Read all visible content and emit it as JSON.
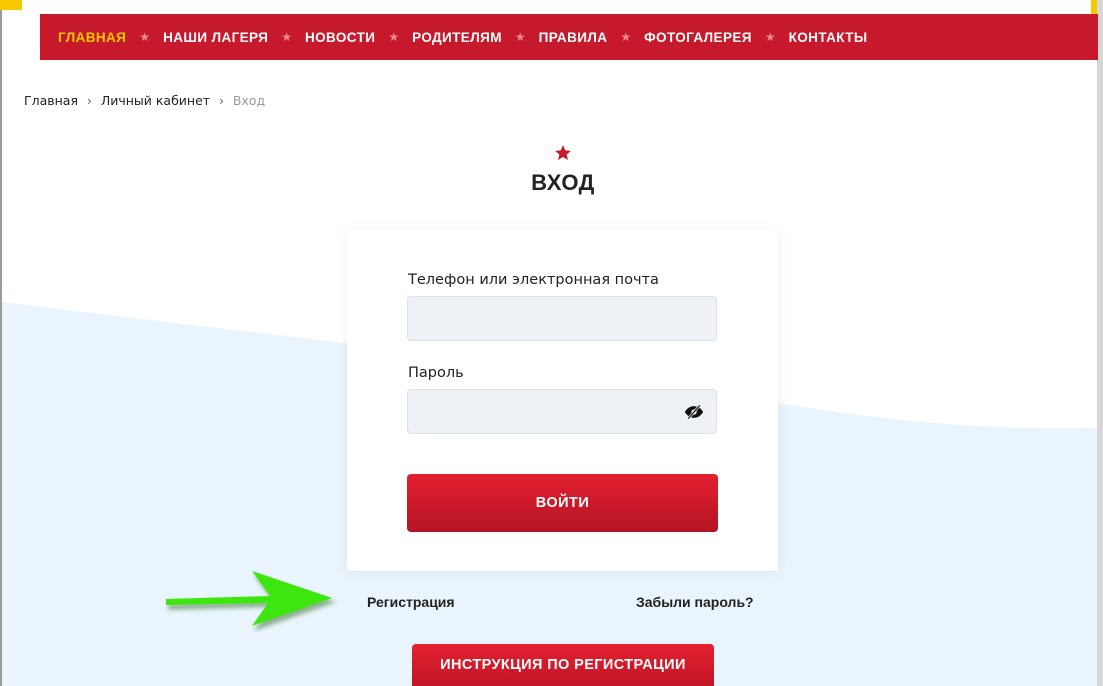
{
  "nav": {
    "items": [
      {
        "label": "ГЛАВНАЯ",
        "active": true
      },
      {
        "label": "НАШИ ЛАГЕРЯ",
        "active": false
      },
      {
        "label": "НОВОСТИ",
        "active": false
      },
      {
        "label": "РОДИТЕЛЯМ",
        "active": false
      },
      {
        "label": "ПРАВИЛА",
        "active": false
      },
      {
        "label": "ФОТОГАЛЕРЕЯ",
        "active": false
      },
      {
        "label": "КОНТАКТЫ",
        "active": false
      }
    ],
    "separator_icon": "star-icon"
  },
  "breadcrumb": {
    "home": "Главная",
    "cabinet": "Личный кабинет",
    "current": "Вход"
  },
  "page": {
    "title": "ВХОД",
    "title_icon": "star-icon"
  },
  "form": {
    "login_label": "Телефон или электронная почта",
    "login_value": "",
    "password_label": "Пароль",
    "password_value": "",
    "password_toggle_icon": "eye-slash-icon",
    "submit_label": "ВОЙТИ"
  },
  "links": {
    "register": "Регистрация",
    "forgot_password": "Забыли пароль?"
  },
  "instructions_button": "ИНСТРУКЦИЯ ПО РЕГИСТРАЦИИ",
  "annotation": {
    "arrow_icon": "green-arrow-icon"
  },
  "colors": {
    "brand_red": "#c61a2c",
    "active_yellow": "#f6c800",
    "input_bg": "#eef2f7",
    "wave_bg": "#eaf4fc",
    "arrow_green": "#3ee60f"
  }
}
